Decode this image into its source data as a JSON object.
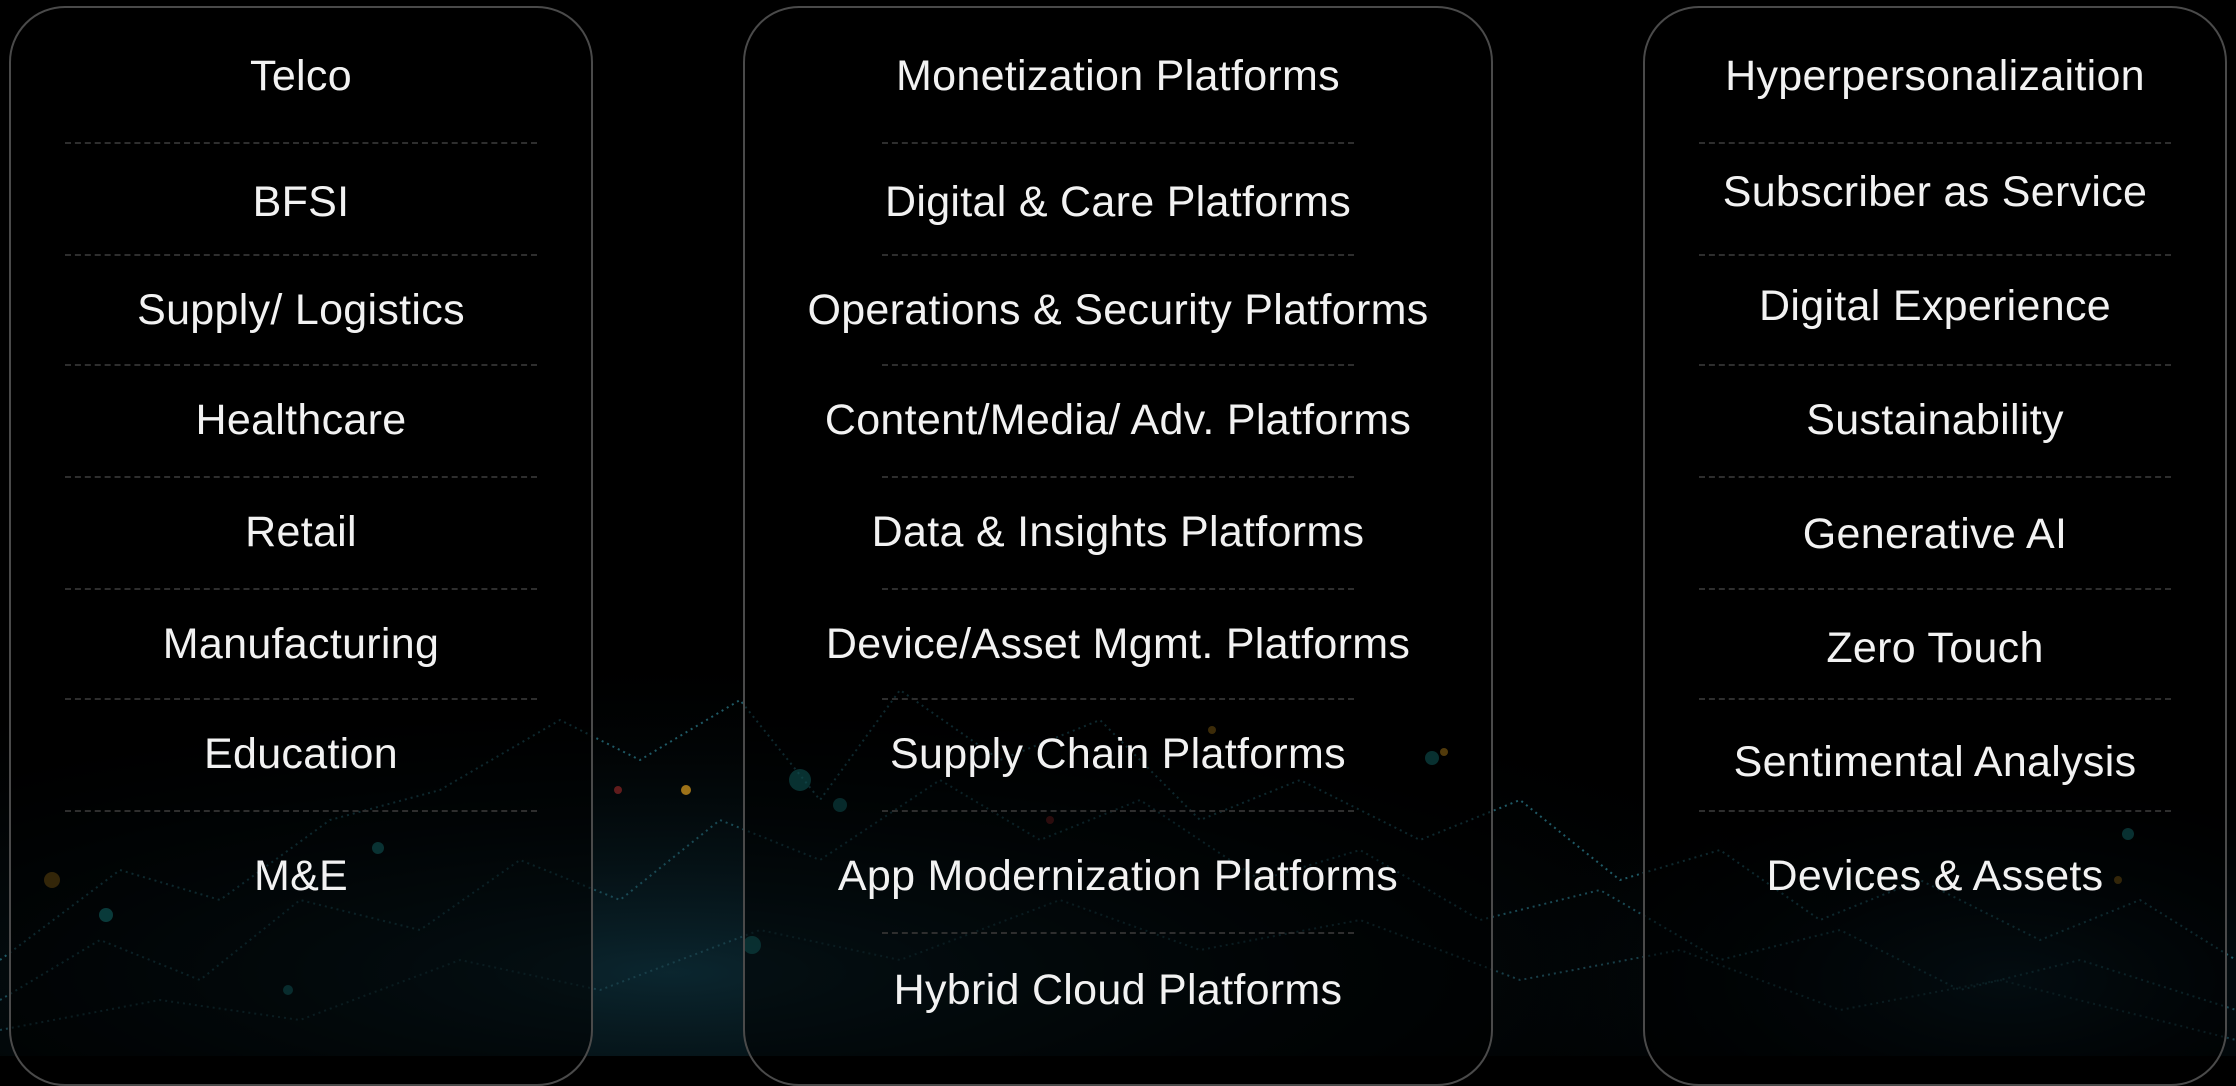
{
  "panels": {
    "industries": {
      "items": [
        "Telco",
        "BFSI",
        "Supply/ Logistics",
        "Healthcare",
        "Retail",
        "Manufacturing",
        "Education",
        "M&E"
      ]
    },
    "platforms": {
      "items": [
        "Monetization Platforms",
        "Digital & Care Platforms",
        "Operations & Security Platforms",
        "Content/Media/ Adv. Platforms",
        "Data & Insights Platforms",
        "Device/Asset Mgmt. Platforms",
        "Supply Chain Platforms",
        "App Modernization Platforms",
        "Hybrid Cloud Platforms"
      ]
    },
    "solutions": {
      "items": [
        "Hyperpersonalizaition",
        "Subscriber as Service",
        "Digital Experience",
        "Sustainability",
        "Generative AI",
        "Zero Touch",
        "Sentimental Analysis",
        "Devices & Assets"
      ]
    }
  },
  "colors": {
    "background": "#000000",
    "panel_border": "#4a4a4a",
    "text": "#f2f2f2",
    "divider": "#2e2e2e",
    "graph_accent": "#1fb3b3",
    "graph_warm": "#e0a020"
  }
}
